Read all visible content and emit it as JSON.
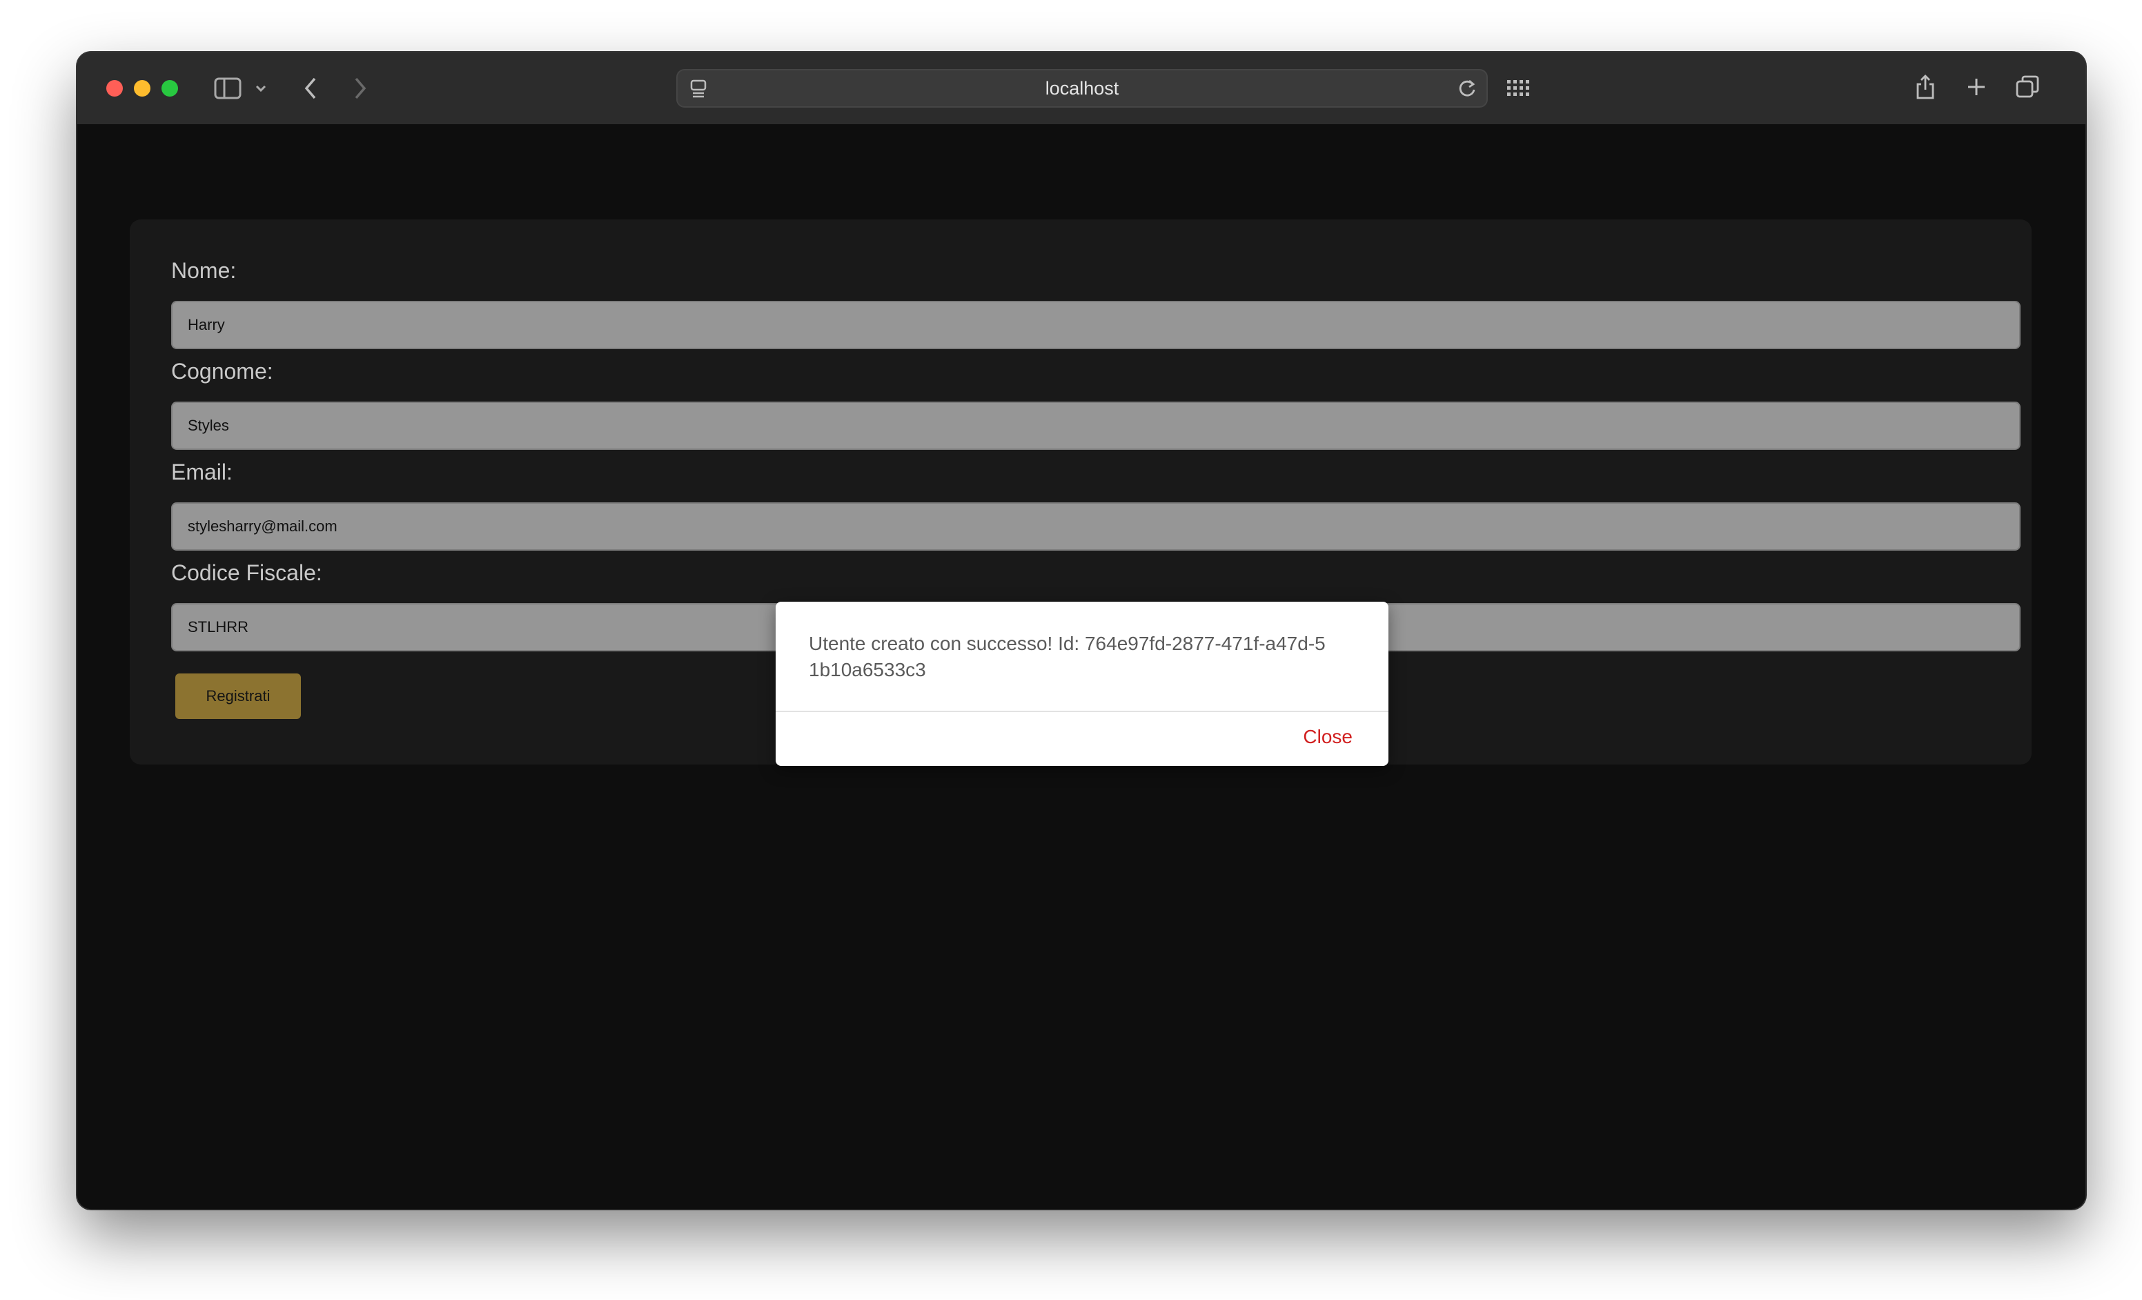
{
  "browser": {
    "url": "localhost"
  },
  "form": {
    "fields": [
      {
        "label": "Nome:",
        "value": "Harry"
      },
      {
        "label": "Cognome:",
        "value": "Styles"
      },
      {
        "label": "Email:",
        "value": "stylesharry@mail.com"
      },
      {
        "label": "Codice Fiscale:",
        "value": "STLHRR"
      }
    ],
    "submit_label": "Registrati"
  },
  "modal": {
    "message": "Utente creato con successo! Id: 764e97fd-2877-471f-a47d-51b10a6533c3",
    "close_label": "Close"
  },
  "colors": {
    "accent_button": "#8c7330",
    "close_text": "#d11f1f"
  }
}
